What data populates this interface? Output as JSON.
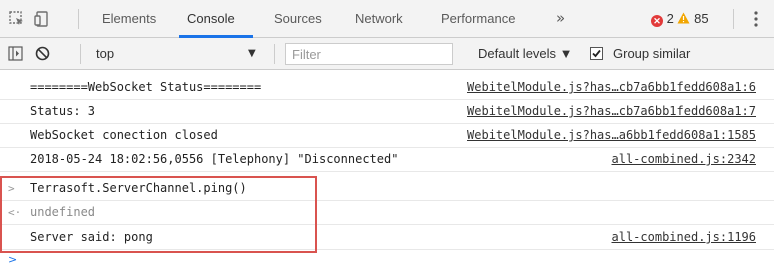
{
  "tabbar": {
    "tabs": [
      {
        "label": "Elements"
      },
      {
        "label": "Console"
      },
      {
        "label": "Sources"
      },
      {
        "label": "Network"
      },
      {
        "label": "Performance"
      }
    ],
    "active_tab": "Console",
    "more_label": "»",
    "error_count": "2",
    "warning_count": "85",
    "icons": [
      "inspect-element-icon",
      "device-toolbar-icon",
      "more-tabs-icon",
      "error-icon",
      "warning-icon",
      "kebab-menu-icon"
    ],
    "accent": "#1a73e8",
    "error_color": "#e23a3a",
    "warning_color": "#f2a600"
  },
  "toolbar": {
    "context": "top",
    "filter_placeholder": "Filter",
    "levels_label": "Default levels ▼",
    "group_similar_label": "Group similar",
    "group_similar_checked": true,
    "icons": [
      "sidebar-toggle-icon",
      "clear-console-icon",
      "dropdown-arrow-icon",
      "checkbox-icon"
    ]
  },
  "console": {
    "messages": [
      {
        "text": "========WebSocket Status========",
        "source": "WebitelModule.js?has…cb7a6bb1fedd608a1:6"
      },
      {
        "text": "Status: 3",
        "source": "WebitelModule.js?has…cb7a6bb1fedd608a1:7"
      },
      {
        "text": "WebSocket conection closed",
        "source": "WebitelModule.js?has…a6bb1fedd608a1:1585"
      },
      {
        "text": "2018-05-24 18:02:56,0556 [Telephony] \"Disconnected\"",
        "source": "all-combined.js:2342"
      },
      {
        "text": "Terrasoft.ServerChannel.ping()",
        "gutter": ">"
      },
      {
        "text": "undefined",
        "gutter": "<·"
      },
      {
        "text": "Server said: pong",
        "source": "all-combined.js:1196"
      }
    ],
    "prompt_symbol": ">",
    "highlight_color": "#d9534f"
  }
}
